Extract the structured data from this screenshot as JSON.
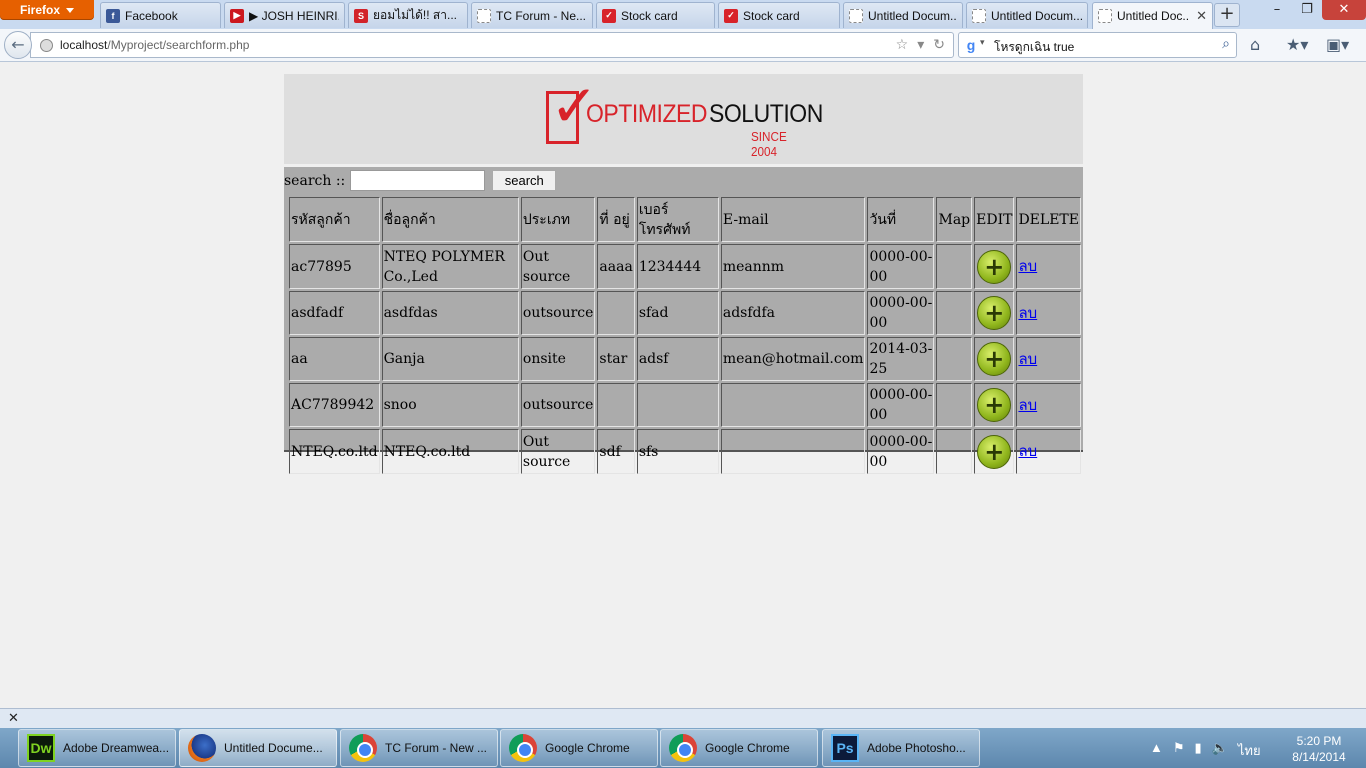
{
  "browser": {
    "menu_button": "Firefox",
    "tabs": [
      {
        "label": "Facebook",
        "icon": "facebook-icon",
        "color": "#3b5998",
        "glyph": "f"
      },
      {
        "label": "▶ JOSH HEINRI...",
        "icon": "youtube-icon",
        "color": "#cc181e",
        "glyph": "▶"
      },
      {
        "label": "ยอมไม่ได้!! สา...",
        "icon": "site-icon",
        "color": "#d2232a",
        "glyph": "S"
      },
      {
        "label": "TC Forum - Ne...",
        "icon": "page-icon",
        "color": "#ffffff",
        "glyph": ""
      },
      {
        "label": "Stock card",
        "icon": "checkbox-icon",
        "color": "#d8232a",
        "glyph": "✓"
      },
      {
        "label": "Stock card",
        "icon": "checkbox-icon",
        "color": "#d8232a",
        "glyph": "✓"
      },
      {
        "label": "Untitled Docum...",
        "icon": "page-icon",
        "color": "#ffffff",
        "glyph": ""
      },
      {
        "label": "Untitled Docum...",
        "icon": "page-icon",
        "color": "#ffffff",
        "glyph": ""
      },
      {
        "label": "Untitled Doc...",
        "icon": "page-icon",
        "color": "#ffffff",
        "glyph": "",
        "active": true
      }
    ],
    "url_host": "localhost",
    "url_path": "/Myproject/searchform.php",
    "search_value": "โหรดูกเฉิน true"
  },
  "page": {
    "logo": {
      "word1": "OPTIMIZED",
      "word2": "SOLUTION",
      "since": "SINCE 2004"
    },
    "search_label": "search ::",
    "search_value": "",
    "search_button": "search",
    "table": {
      "headers": [
        "รหัสลูกค้า",
        "ชื่อลูกค้า",
        "ประเภท",
        "ที่ อยู่",
        "เบอร์ โทรศัพท์",
        "E-mail",
        "วันที่",
        "Map",
        "EDIT",
        "DELETE"
      ],
      "rows": [
        {
          "id": "ac77895",
          "name": "NTEQ POLYMER Co.,Led",
          "type": "Out source",
          "address": "aaaa",
          "phone": "1234444",
          "email": "meannm",
          "date": "0000-00-00",
          "map": "",
          "delete": "ลบ"
        },
        {
          "id": "asdfadf",
          "name": "asdfdas",
          "type": "outsource",
          "address": "",
          "phone": "sfad",
          "email": "adsfdfa",
          "date": "0000-00-00",
          "map": "",
          "delete": "ลบ"
        },
        {
          "id": "aa",
          "name": "Ganja",
          "type": "onsite",
          "address": "star",
          "phone": "adsf",
          "email": "mean@hotmail.com",
          "date": "2014-03-25",
          "map": "",
          "delete": "ลบ"
        },
        {
          "id": "AC7789942",
          "name": "snoo",
          "type": "outsource",
          "address": "",
          "phone": "",
          "email": "",
          "date": "0000-00-00",
          "map": "",
          "delete": "ลบ"
        },
        {
          "id": "NTEQ.co.ltd",
          "name": "NTEQ.co.ltd",
          "type": "Out source",
          "address": "sdf",
          "phone": "sfs",
          "email": "",
          "date": "0000-00-00",
          "map": "",
          "delete": "ลบ"
        }
      ]
    }
  },
  "taskbar": {
    "items": [
      {
        "label": "Adobe Dreamwea...",
        "icon": "dreamweaver-icon",
        "glyph": "Dw",
        "cls": "ico-dw"
      },
      {
        "label": "Untitled Docume...",
        "icon": "firefox-icon",
        "glyph": "",
        "cls": "ico-ff",
        "active": true
      },
      {
        "label": "TC Forum - New ...",
        "icon": "chrome-icon",
        "glyph": "",
        "cls": "ico-ch"
      },
      {
        "label": "Google Chrome",
        "icon": "chrome-icon",
        "glyph": "",
        "cls": "ico-ch"
      },
      {
        "label": "Google Chrome",
        "icon": "chrome-icon",
        "glyph": "",
        "cls": "ico-ch"
      },
      {
        "label": "Adobe Photosho...",
        "icon": "photoshop-icon",
        "glyph": "Ps",
        "cls": "ico-ps"
      }
    ],
    "language": "ไทย",
    "time": "5:20 PM",
    "date": "8/14/2014"
  }
}
